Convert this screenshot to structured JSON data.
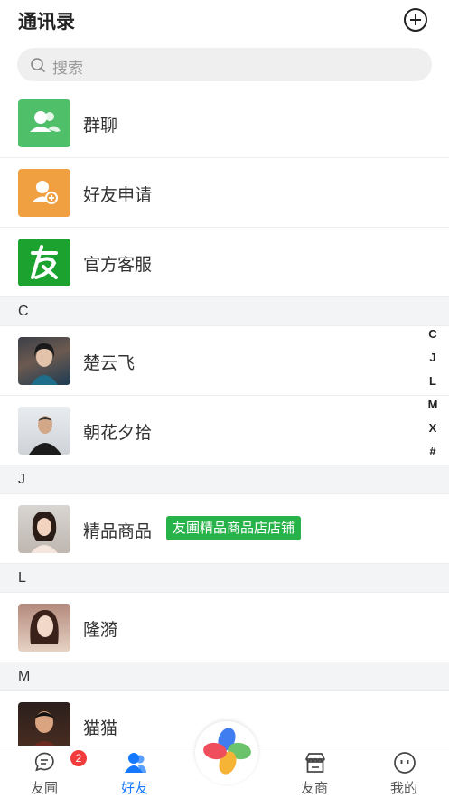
{
  "header": {
    "title": "通讯录",
    "add_icon": "plus-circle-icon"
  },
  "search": {
    "placeholder": "搜索"
  },
  "top_items": [
    {
      "label": "群聊",
      "icon": "group-users-icon",
      "color": "#4fbf6a"
    },
    {
      "label": "好友申请",
      "icon": "add-friend-icon",
      "color": "#f0a040"
    },
    {
      "label": "官方客服",
      "icon": "you-logo-icon",
      "color": "#1ba22f"
    }
  ],
  "sections": [
    {
      "letter": "C",
      "contacts": [
        {
          "name": "楚云飞"
        },
        {
          "name": "朝花夕拾"
        }
      ]
    },
    {
      "letter": "J",
      "contacts": [
        {
          "name": "精品商品",
          "tag": "友圃精品商品店店铺"
        }
      ]
    },
    {
      "letter": "L",
      "contacts": [
        {
          "name": "隆漪"
        }
      ]
    },
    {
      "letter": "M",
      "contacts": [
        {
          "name": "猫猫"
        }
      ]
    }
  ],
  "index_letters": [
    "C",
    "J",
    "L",
    "M",
    "X",
    "#"
  ],
  "tabbar": {
    "items": [
      {
        "label": "友圃",
        "icon": "chat-bubble-icon",
        "badge": "2"
      },
      {
        "label": "好友",
        "icon": "contacts-icon",
        "active": true
      },
      {
        "label": "友商",
        "icon": "store-icon"
      },
      {
        "label": "我的",
        "icon": "smiley-icon"
      }
    ],
    "center_icon": "pinwheel-icon"
  },
  "colors": {
    "accent": "#1677ff",
    "tag_green": "#27b24a",
    "badge_red": "#f23c3c"
  }
}
